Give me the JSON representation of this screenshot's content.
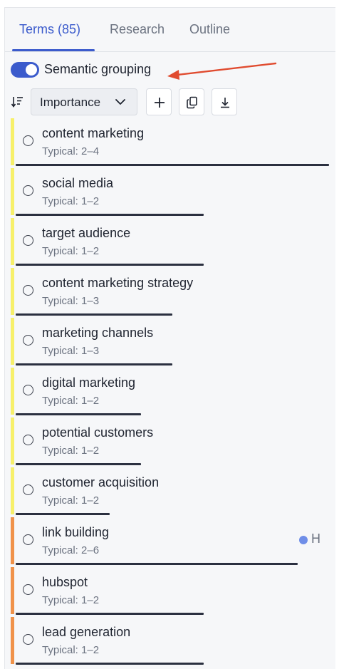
{
  "tabs": [
    {
      "label": "Terms (85)",
      "active": true
    },
    {
      "label": "Research",
      "active": false
    },
    {
      "label": "Outline",
      "active": false
    }
  ],
  "grouping": {
    "label": "Semantic grouping",
    "enabled": true
  },
  "sort": {
    "selected": "Importance"
  },
  "colors": {
    "accent": "#3b5bcc",
    "group_yellow": "#f7f06a",
    "group_orange": "#f0924a",
    "progress": "#2b3040",
    "annotation_arrow": "#e04b2f",
    "tag_dot": "#6f8ee8"
  },
  "terms": [
    {
      "name": "content marketing",
      "typical": "Typical: 2–4",
      "group": "yellow",
      "progress": 1.0
    },
    {
      "name": "social media",
      "typical": "Typical: 1–2",
      "group": "yellow",
      "progress": 0.6
    },
    {
      "name": "target audience",
      "typical": "Typical: 1–2",
      "group": "yellow",
      "progress": 0.6
    },
    {
      "name": "content marketing strategy",
      "typical": "Typical: 1–3",
      "group": "yellow",
      "progress": 0.5
    },
    {
      "name": "marketing channels",
      "typical": "Typical: 1–3",
      "group": "yellow",
      "progress": 0.5
    },
    {
      "name": "digital marketing",
      "typical": "Typical: 1–2",
      "group": "yellow",
      "progress": 0.4
    },
    {
      "name": "potential customers",
      "typical": "Typical: 1–2",
      "group": "yellow",
      "progress": 0.4
    },
    {
      "name": "customer acquisition",
      "typical": "Typical: 1–2",
      "group": "yellow",
      "progress": 0.3
    },
    {
      "name": "link building",
      "typical": "Typical: 2–6",
      "group": "orange",
      "progress": 0.9,
      "tag": "H"
    },
    {
      "name": "hubspot",
      "typical": "Typical: 1–2",
      "group": "orange",
      "progress": 0.6
    },
    {
      "name": "lead generation",
      "typical": "Typical: 1–2",
      "group": "orange",
      "progress": 0.6
    }
  ]
}
